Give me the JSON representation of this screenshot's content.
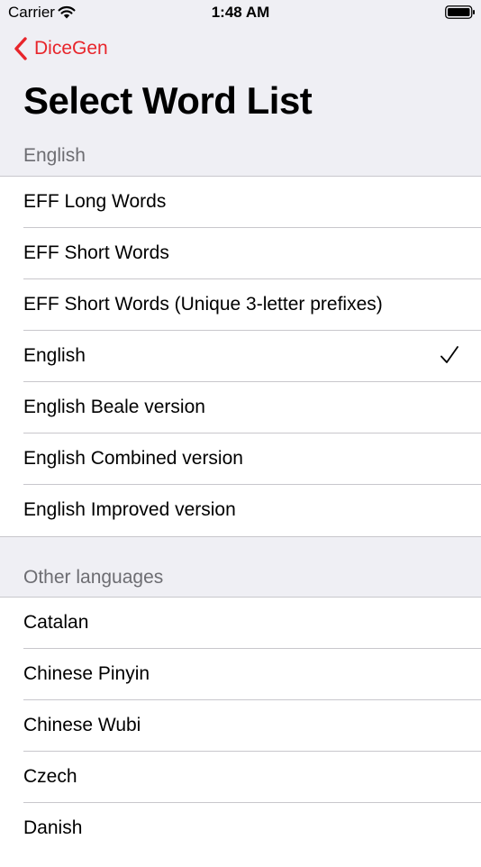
{
  "status_bar": {
    "carrier": "Carrier",
    "time": "1:48 AM"
  },
  "nav": {
    "back_label": "DiceGen",
    "accent_color": "#e8252b"
  },
  "page": {
    "title": "Select Word List"
  },
  "sections": [
    {
      "header": "English",
      "items": [
        {
          "label": "EFF Long Words",
          "selected": false
        },
        {
          "label": "EFF Short Words",
          "selected": false
        },
        {
          "label": "EFF Short Words (Unique 3-letter prefixes)",
          "selected": false
        },
        {
          "label": "English",
          "selected": true
        },
        {
          "label": "English Beale version",
          "selected": false
        },
        {
          "label": "English Combined version",
          "selected": false
        },
        {
          "label": "English Improved version",
          "selected": false
        }
      ]
    },
    {
      "header": "Other languages",
      "items": [
        {
          "label": "Catalan",
          "selected": false
        },
        {
          "label": "Chinese Pinyin",
          "selected": false
        },
        {
          "label": "Chinese Wubi",
          "selected": false
        },
        {
          "label": "Czech",
          "selected": false
        },
        {
          "label": "Danish",
          "selected": false
        }
      ]
    }
  ]
}
